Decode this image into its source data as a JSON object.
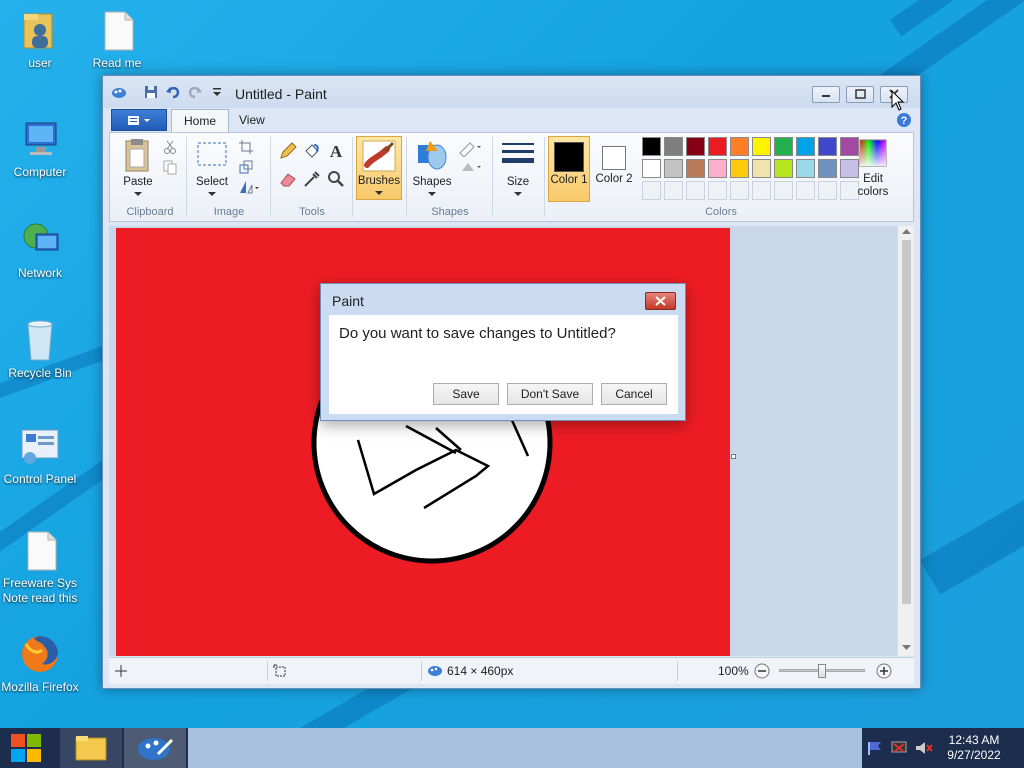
{
  "desktop": {
    "icons": [
      {
        "label": "user"
      },
      {
        "label": "Read me"
      },
      {
        "label": "Computer"
      },
      {
        "label": "Network"
      },
      {
        "label": "Recycle Bin"
      },
      {
        "label": "Control Panel"
      },
      {
        "label": "Freeware Sys Note read this"
      },
      {
        "label": "Mozilla Firefox"
      }
    ]
  },
  "window": {
    "title": "Untitled - Paint",
    "tabs": {
      "home": "Home",
      "view": "View"
    },
    "ribbon": {
      "clipboard": {
        "label": "Clipboard",
        "paste": "Paste"
      },
      "image": {
        "label": "Image",
        "select": "Select"
      },
      "tools": {
        "label": "Tools"
      },
      "brushes": {
        "label": "Brushes"
      },
      "shapes": {
        "label": "Shapes",
        "button": "Shapes"
      },
      "size": {
        "label": "Size"
      },
      "colors": {
        "label": "Colors",
        "color1": "Color 1",
        "color2": "Color 2",
        "edit": "Edit colors",
        "color1_value": "#000000",
        "color2_value": "#ffffff",
        "palette_row1": [
          "#000000",
          "#7f7f7f",
          "#880015",
          "#ed1c24",
          "#ff7f27",
          "#fff200",
          "#22b14c",
          "#00a2e8",
          "#3f48cc",
          "#a349a4"
        ],
        "palette_row2": [
          "#ffffff",
          "#c3c3c3",
          "#b97a57",
          "#ffaec9",
          "#ffc90e",
          "#efe4b0",
          "#b5e61d",
          "#99d9ea",
          "#7092be",
          "#c8bfe7"
        ]
      }
    },
    "canvas": {
      "background": "#ed1c24"
    },
    "status": {
      "size": "614 × 460px",
      "zoom": "100%"
    }
  },
  "dialog": {
    "title": "Paint",
    "message": "Do you want to save changes to Untitled?",
    "buttons": {
      "save": "Save",
      "dont_save": "Don't Save",
      "cancel": "Cancel"
    }
  },
  "taskbar": {
    "time": "12:43 AM",
    "date": "9/27/2022"
  }
}
